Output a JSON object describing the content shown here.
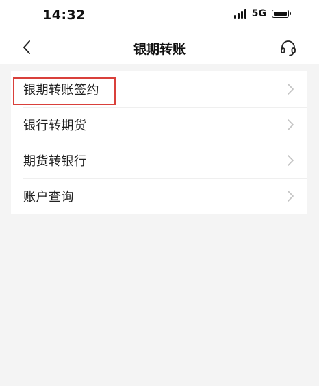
{
  "status_bar": {
    "time": "14:32",
    "network": "5G",
    "icons": [
      "signal-icon",
      "battery-icon"
    ]
  },
  "nav_bar": {
    "title": "银期转账",
    "icons": [
      "chevron-left-icon",
      "headset-icon"
    ]
  },
  "menu": {
    "items": [
      {
        "label": "银期转账签约"
      },
      {
        "label": "银行转期货"
      },
      {
        "label": "期货转银行"
      },
      {
        "label": "账户查询"
      }
    ]
  },
  "colors": {
    "highlight": "#d9403b",
    "page_background": "#f4f4f4",
    "card_background": "#ffffff",
    "chevron": "#c4c4c4"
  }
}
